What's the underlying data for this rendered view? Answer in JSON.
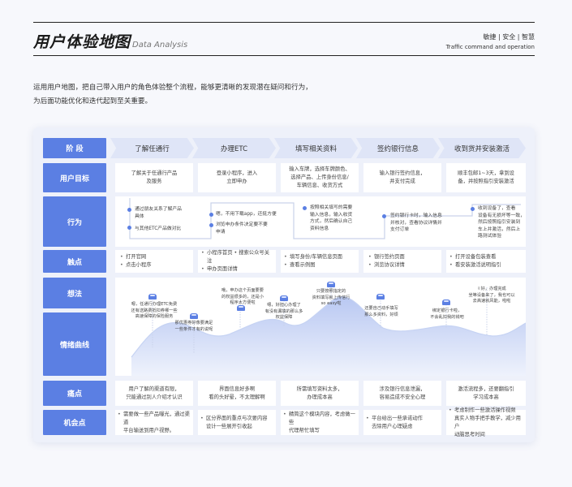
{
  "header": {
    "title": "用户体验地图",
    "arrows": "››››",
    "subtitle": "Data Analysis",
    "tags": "敏捷 | 安全 | 智慧",
    "tags_en": "Traffic command and operation"
  },
  "intro": {
    "line1": "运用用户地图，把自己带入用户的角色体验整个流程，能够更清晰的发现潜在疑问和行为，",
    "line2": "为后面功能优化和迭代起到至关重要。"
  },
  "labels": {
    "stage": "阶  段",
    "goal": "用户目标",
    "behavior": "行为",
    "touch": "触点",
    "thought": "想法",
    "emotion": "情绪曲线",
    "pain": "痛点",
    "opportunity": "机会点"
  },
  "stages": [
    "了解任通行",
    "办理ETC",
    "填写相关资料",
    "签约银行信息",
    "收到货并安装激活"
  ],
  "goals": [
    "了解关于任通行产品\n及服务",
    "登录小程序，进入\n立即申办",
    "输入车牌，选择车牌颜色、\n选择产品、上传身份信息/\n车辆信息、收货方式",
    "输入银行签约信息，\n并支付完成",
    "顺丰包邮1~3天，拿到设\n备，并按照指引安装激活"
  ],
  "behaviors": [
    "通过朋友关系了解产品\n具体",
    "与其他ETC产品做对比",
    "嗯，不用下载app，还挺方便",
    "浏览申办条件决定要不要\n申请",
    "按照相关填写的需要\n输入信息，输入收货\n方式，然后确认自己\n资料信息",
    "签约银行卡时，输入信息\n并核对，查看协议详情并\n支付订单",
    "收到设备了，查看\n设备有无损坏等一致，\n然后按照指引安装到\n车上并激活，然后上\n路测试体验"
  ],
  "touchpoints": [
    [
      "打开官网",
      "点击小程序"
    ],
    [
      "小程序首页",
      "搜索公众号关注",
      "申办页面详情"
    ],
    [
      "填写身份/车辆信息页面",
      "查看示例图"
    ],
    [
      "银行签约页面",
      "浏览协议详情"
    ],
    [
      "打开设备包装查看",
      "看安装激活说明指引"
    ]
  ],
  "thoughts": [
    "嗯，任通行办理ETC免费\n还有送路费抵扣券哪一些\n高速保障的保险服务",
    "那优惠券好像要满足\n一些条件才有的说呢",
    "哦，申办这个页面要要\n的权益很多的，还是小\n程序太方便啦",
    "嗯，好担心办理了\n有没有漏填的那么多\n权益保障",
    "只要按照指定的\n资料填写就上传信行\nso easy啦",
    "还要自己动手填写\n那么多资料，好烦",
    "绑定银行卡啦，\n不会乱扣我的钱吧",
    "✌好，办理完成\n坐等设备来了，我也可以\n去高速就风能，啦啦"
  ],
  "pains": [
    "用户了解的渠道有限，\n只能通过别人介绍才认识",
    "界面信息好多啊\n看的头好晕，不太理解啊",
    "所需填写资料太多，\n办理成本高",
    "涉及银行信息泄漏，\n容易造成不安全心理",
    "激活流程多，还要翻指引\n学习成本高"
  ],
  "opportunities": [
    "需要做一些产品曝光，通过渠道\n平台输送到用户视野。",
    "区分界面的重点与次要内容\n设计一些展开引收起",
    "精简这个模块内容，考虑做一些\n代理帮忙填写",
    "平台给出一些承诺动作\n去除用户心理疑虑",
    "考虑制作一些激活操作视频\n真实人物手把手教学，减少用户\n动脑思考时间"
  ],
  "colors": {
    "accent": "#5b7fe3",
    "stage_bg": "#dfe5f7",
    "card_bg": "#eef1fa"
  }
}
